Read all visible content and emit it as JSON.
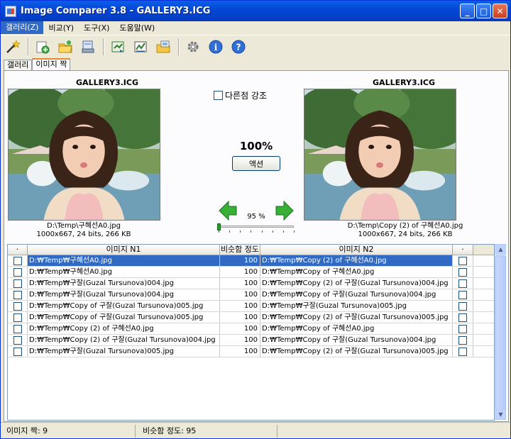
{
  "window": {
    "title": "Image Comparer 3.8 - GALLERY3.ICG",
    "btn_min": "_",
    "btn_max": "□",
    "btn_close": "✕"
  },
  "menu": [
    "갤러리(Z)",
    "비교(Y)",
    "도구(X)",
    "도움말(W)"
  ],
  "toolbar_icons": [
    "wand-icon",
    "add-image-icon",
    "open-folder-icon",
    "scan-icon",
    "compare-icon",
    "compare-lines-icon",
    "gallery-icon",
    "settings-icon",
    "info-icon",
    "help-icon"
  ],
  "tabs": [
    "갤러리",
    "이미지 짝"
  ],
  "compare": {
    "left": {
      "title": "GALLERY3.ICG",
      "path": "D:\\Temp\\구혜선A0.jpg",
      "meta": "1000x667, 24 bits, 266 KB"
    },
    "right": {
      "title": "GALLERY3.ICG",
      "path": "D:\\Temp\\Copy (2) of 구혜선A0.jpg",
      "meta": "1000x667, 24 bits, 266 KB"
    },
    "highlight_label": "다른점 강조",
    "highlight_checked": false,
    "percent": "100%",
    "action_label": "액션",
    "zoom_label": "95 %",
    "zoom_fraction": 0.0
  },
  "table": {
    "headers": {
      "check_left": "·",
      "name1": "이미지 N1",
      "similarity": "비슷함 정도",
      "name2": "이미지 N2",
      "check_right": "·"
    },
    "rows": [
      {
        "n1": "D:₩Temp₩구혜선A0.jpg",
        "sim": "100",
        "n2": "D:₩Temp₩Copy (2) of 구혜선A0.jpg"
      },
      {
        "n1": "D:₩Temp₩구혜선A0.jpg",
        "sim": "100",
        "n2": "D:₩Temp₩Copy of 구혜선A0.jpg"
      },
      {
        "n1": "D:₩Temp₩구잘(Guzal Tursunova)004.jpg",
        "sim": "100",
        "n2": "D:₩Temp₩Copy (2) of 구잘(Guzal Tursunova)004.jpg"
      },
      {
        "n1": "D:₩Temp₩구잘(Guzal Tursunova)004.jpg",
        "sim": "100",
        "n2": "D:₩Temp₩Copy of 구잘(Guzal Tursunova)004.jpg"
      },
      {
        "n1": "D:₩Temp₩Copy of 구잘(Guzal Tursunova)005.jpg",
        "sim": "100",
        "n2": "D:₩Temp₩구잘(Guzal Tursunova)005.jpg"
      },
      {
        "n1": "D:₩Temp₩Copy of 구잘(Guzal Tursunova)005.jpg",
        "sim": "100",
        "n2": "D:₩Temp₩Copy (2) of 구잘(Guzal Tursunova)005.jpg"
      },
      {
        "n1": "D:₩Temp₩Copy (2) of 구혜선A0.jpg",
        "sim": "100",
        "n2": "D:₩Temp₩Copy of 구혜선A0.jpg"
      },
      {
        "n1": "D:₩Temp₩Copy (2) of 구잘(Guzal Tursunova)004.jpg",
        "sim": "100",
        "n2": "D:₩Temp₩Copy of 구잘(Guzal Tursunova)004.jpg"
      },
      {
        "n1": "D:₩Temp₩구잘(Guzal Tursunova)005.jpg",
        "sim": "100",
        "n2": "D:₩Temp₩Copy (2) of 구잘(Guzal Tursunova)005.jpg"
      }
    ]
  },
  "scroll": {
    "up": "▲",
    "down": "▼"
  },
  "status": {
    "pairs": "이미지 짝: 9",
    "similarity": "비슷함 정도: 95"
  },
  "colors": {
    "selection": "#316ac5",
    "titlebar": "#0548d6",
    "accent_tab": "#e68b2c"
  }
}
